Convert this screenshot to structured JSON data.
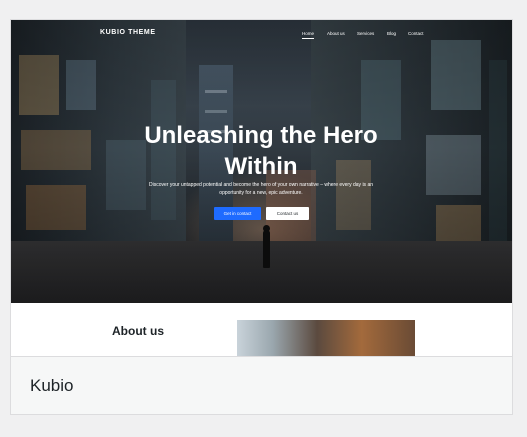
{
  "theme_card": {
    "name": "Kubio",
    "preview": {
      "logo": "KUBIO THEME",
      "nav": [
        "Home",
        "About us",
        "Services",
        "Blog",
        "Contact"
      ],
      "hero_title_line1": "Unleashing the Hero",
      "hero_title_line2": "Within",
      "hero_subtitle_line1": "Discover your untapped potential and become the hero of your own narrative – where every day is an",
      "hero_subtitle_line2": "opportunity for a new, epic adventure.",
      "primary_button": "Get in contact",
      "secondary_button": "Contact us",
      "about_title": "About us"
    }
  },
  "colors": {
    "page_bg": "#f0f0f1",
    "card_border": "#dcdcde",
    "footer_bg": "#f6f7f7",
    "primary_button": "#1e6bff",
    "text_dark": "#1d2327"
  }
}
